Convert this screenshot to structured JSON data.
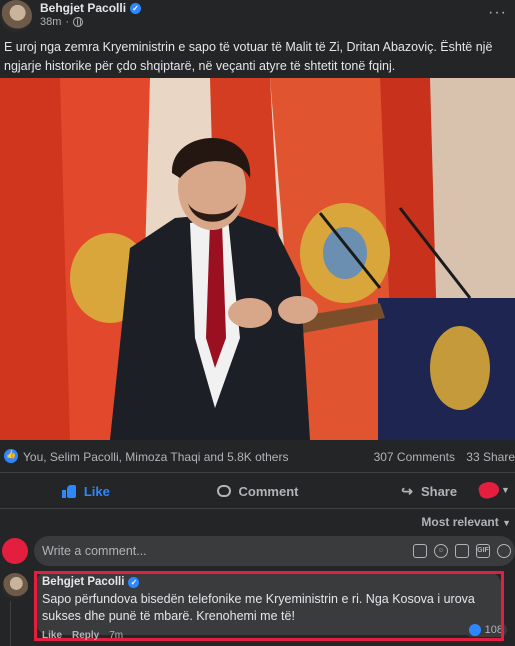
{
  "post": {
    "author": "Behgjet Pacolli",
    "time": "38m",
    "text": "E uroj nga zemra Kryeministrin e sapo të votuar të Malit të Zi, Dritan Abazoviç. Është një ngjarje historike për çdo shqiptarë, në veçanti atyre të shtetit tonë fqinj."
  },
  "reactions": {
    "summary": "You, Selim Pacolli, Mimoza Thaqi and 5.8K others",
    "comments": "307 Comments",
    "shares": "33 Share"
  },
  "actions": {
    "like": "Like",
    "comment": "Comment",
    "share": "Share"
  },
  "sort": {
    "label": "Most relevant"
  },
  "compose": {
    "placeholder": "Write a comment..."
  },
  "comment": {
    "author": "Behgjet Pacolli",
    "text": "Sapo përfundova bisedën telefonike me Kryeministrin e ri. Nga Kosova i urova sukses dhe punë të mbarë. Krenohemi me të!",
    "likes": "108",
    "like_label": "Like",
    "reply_label": "Reply",
    "time": "7m"
  },
  "colors": {
    "accent": "#2d88ff",
    "highlight": "#e41e3f",
    "background": "#242526"
  }
}
